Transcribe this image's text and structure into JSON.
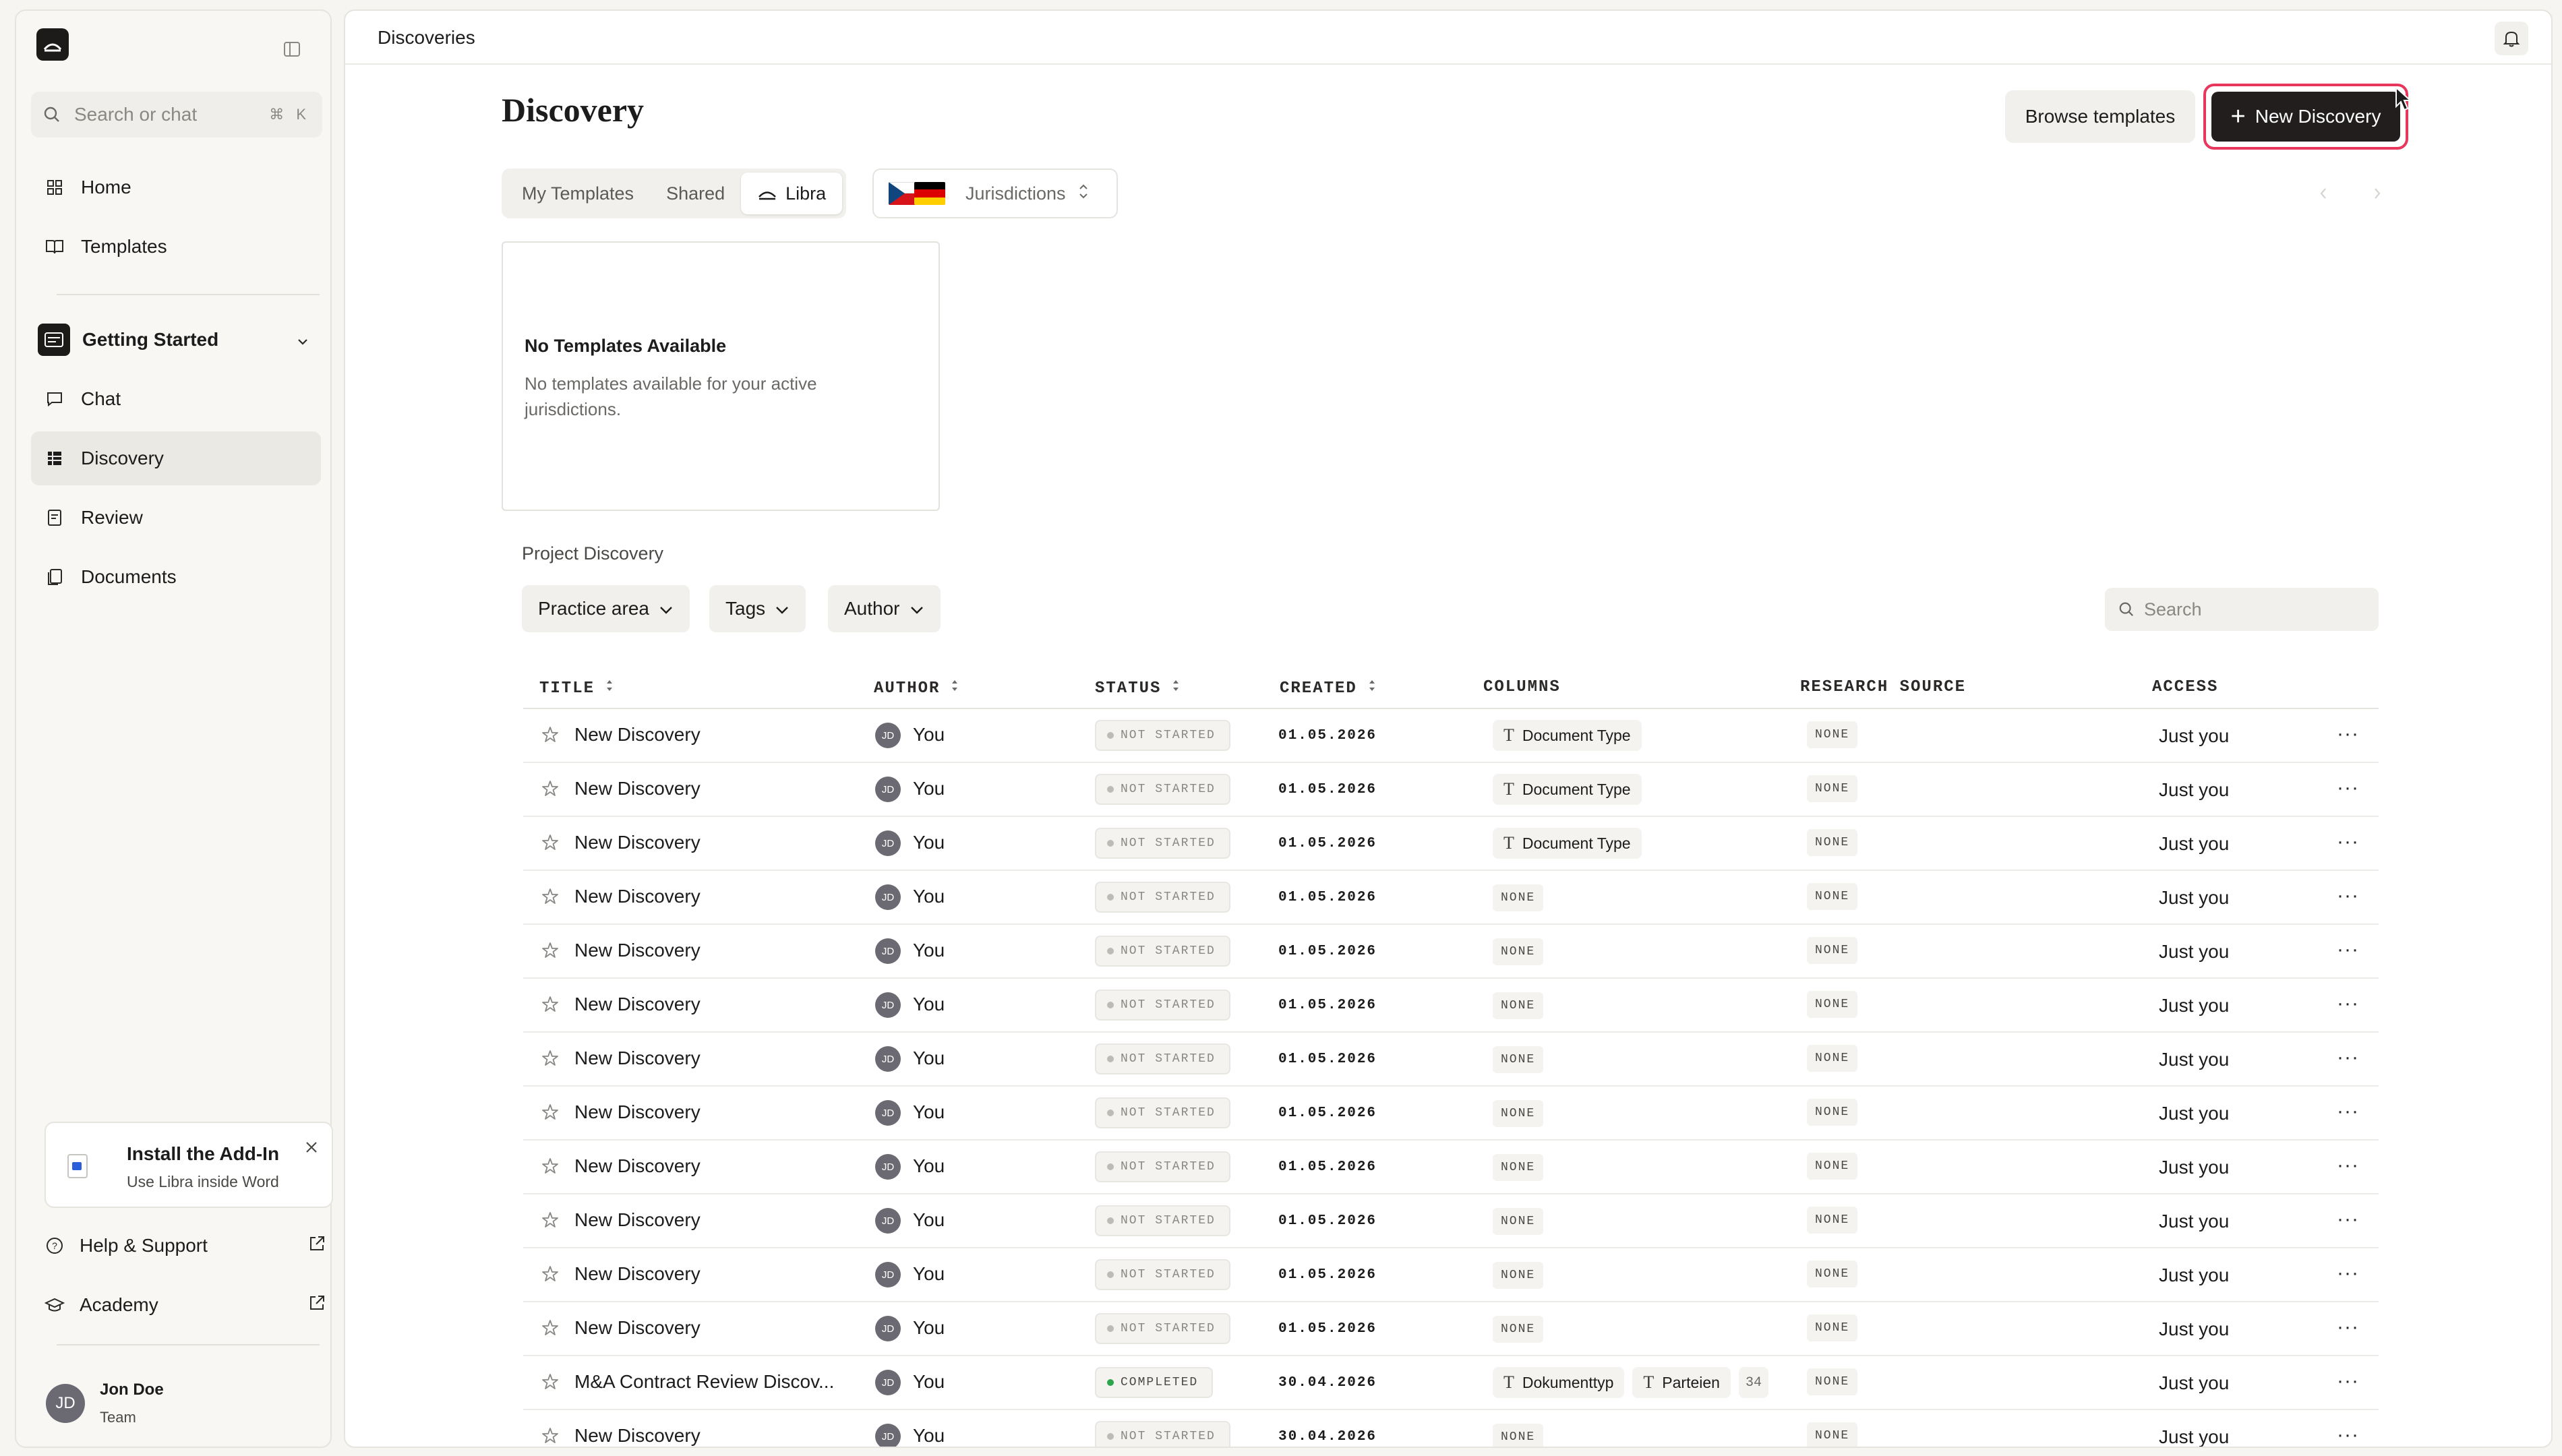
{
  "sidebar": {
    "search_placeholder": "Search or chat",
    "search_shortcut": "⌘ K",
    "nav": [
      {
        "label": "Home",
        "icon": "grid-icon"
      },
      {
        "label": "Templates",
        "icon": "book-icon"
      }
    ],
    "workspace": {
      "label": "Getting Started"
    },
    "workspace_nav": [
      {
        "label": "Chat",
        "icon": "chat-icon"
      },
      {
        "label": "Discovery",
        "icon": "table-icon",
        "active": true
      },
      {
        "label": "Review",
        "icon": "review-icon"
      },
      {
        "label": "Documents",
        "icon": "documents-icon"
      }
    ],
    "addin": {
      "title": "Install the Add-In",
      "subtitle": "Use Libra inside Word"
    },
    "footer": [
      {
        "label": "Help & Support",
        "icon": "help-icon"
      },
      {
        "label": "Academy",
        "icon": "academy-icon"
      }
    ],
    "user": {
      "initials": "JD",
      "name": "Jon Doe",
      "team": "Team"
    }
  },
  "topbar": {
    "breadcrumb": "Discoveries"
  },
  "page": {
    "title": "Discovery",
    "browse_label": "Browse templates",
    "new_label": "New Discovery",
    "tabs": [
      "My Templates",
      "Shared",
      "Libra"
    ],
    "active_tab": "Libra",
    "jurisdictions_label": "Jurisdictions",
    "empty_card": {
      "title": "No Templates Available",
      "description": "No templates available for your active jurisdictions."
    },
    "section_title": "Project Discovery",
    "filters": [
      "Practice area",
      "Tags",
      "Author"
    ],
    "search_placeholder": "Search"
  },
  "table": {
    "headers": {
      "title": "TITLE",
      "author": "AUTHOR",
      "status": "STATUS",
      "created": "CREATED",
      "columns": "COLUMNS",
      "research_source": "RESEARCH SOURCE",
      "access": "ACCESS"
    },
    "rows": [
      {
        "title": "New Discovery",
        "initials": "JD",
        "author": "You",
        "status": "NOT STARTED",
        "created": "01.05.2026",
        "columns": [
          "Document Type"
        ],
        "research_source": "NONE",
        "access": "Just you"
      },
      {
        "title": "New Discovery",
        "initials": "JD",
        "author": "You",
        "status": "NOT STARTED",
        "created": "01.05.2026",
        "columns": [
          "Document Type"
        ],
        "research_source": "NONE",
        "access": "Just you"
      },
      {
        "title": "New Discovery",
        "initials": "JD",
        "author": "You",
        "status": "NOT STARTED",
        "created": "01.05.2026",
        "columns": [
          "Document Type"
        ],
        "research_source": "NONE",
        "access": "Just you"
      },
      {
        "title": "New Discovery",
        "initials": "JD",
        "author": "You",
        "status": "NOT STARTED",
        "created": "01.05.2026",
        "columns": [],
        "research_source": "NONE",
        "access": "Just you"
      },
      {
        "title": "New Discovery",
        "initials": "JD",
        "author": "You",
        "status": "NOT STARTED",
        "created": "01.05.2026",
        "columns": [],
        "research_source": "NONE",
        "access": "Just you"
      },
      {
        "title": "New Discovery",
        "initials": "JD",
        "author": "You",
        "status": "NOT STARTED",
        "created": "01.05.2026",
        "columns": [],
        "research_source": "NONE",
        "access": "Just you"
      },
      {
        "title": "New Discovery",
        "initials": "JD",
        "author": "You",
        "status": "NOT STARTED",
        "created": "01.05.2026",
        "columns": [],
        "research_source": "NONE",
        "access": "Just you"
      },
      {
        "title": "New Discovery",
        "initials": "JD",
        "author": "You",
        "status": "NOT STARTED",
        "created": "01.05.2026",
        "columns": [],
        "research_source": "NONE",
        "access": "Just you"
      },
      {
        "title": "New Discovery",
        "initials": "JD",
        "author": "You",
        "status": "NOT STARTED",
        "created": "01.05.2026",
        "columns": [],
        "research_source": "NONE",
        "access": "Just you"
      },
      {
        "title": "New Discovery",
        "initials": "JD",
        "author": "You",
        "status": "NOT STARTED",
        "created": "01.05.2026",
        "columns": [],
        "research_source": "NONE",
        "access": "Just you"
      },
      {
        "title": "New Discovery",
        "initials": "JD",
        "author": "You",
        "status": "NOT STARTED",
        "created": "01.05.2026",
        "columns": [],
        "research_source": "NONE",
        "access": "Just you"
      },
      {
        "title": "New Discovery",
        "initials": "JD",
        "author": "You",
        "status": "NOT STARTED",
        "created": "01.05.2026",
        "columns": [],
        "research_source": "NONE",
        "access": "Just you"
      },
      {
        "title": "M&A Contract Review Discov...",
        "initials": "JD",
        "author": "You",
        "status": "COMPLETED",
        "created": "30.04.2026",
        "columns": [
          "Dokumenttyp",
          "Parteien"
        ],
        "columns_extra": "34",
        "research_source": "NONE",
        "access": "Just you"
      },
      {
        "title": "New Discovery",
        "initials": "JD",
        "author": "You",
        "status": "NOT STARTED",
        "created": "30.04.2026",
        "columns": [],
        "research_source": "NONE",
        "access": "Just you"
      }
    ],
    "none_label": "NONE"
  },
  "colors": {
    "accent": "#211e1d",
    "highlight": "#e8365d",
    "completed": "#2ea44f"
  }
}
